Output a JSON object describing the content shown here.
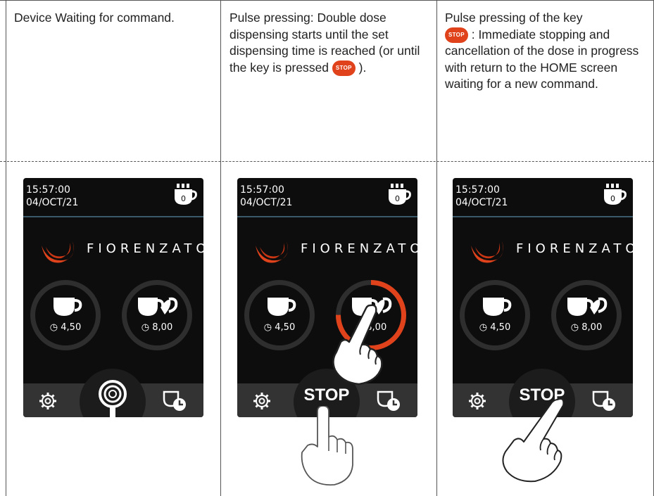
{
  "columns": [
    {
      "text": "Device Waiting for command."
    },
    {
      "text_part1": "Pulse pressing: Double dose dispensing starts until the set dispensing time is reached (or until the key is pressed",
      "text_part2": ")."
    },
    {
      "text_part1": "Pulse pressing of the key",
      "text_part2": ": Immediate stopping and cancellation of the dose in progress with return to the HOME screen waiting for a new command."
    }
  ],
  "stop_chip_label": "STOP",
  "screen": {
    "time": "15:57:00",
    "date": "04/OCT/21",
    "counter": "0",
    "brand": "FIORENZATO",
    "single_dose_time": "4,50",
    "double_dose_time": "8,00",
    "stop_button_label": "STOP"
  },
  "colors": {
    "accent": "#e0431b",
    "ring": "#2e2e2e",
    "bar": "#333333",
    "screen_bg": "#0d0d0d"
  },
  "dispense_progress": 0.75
}
